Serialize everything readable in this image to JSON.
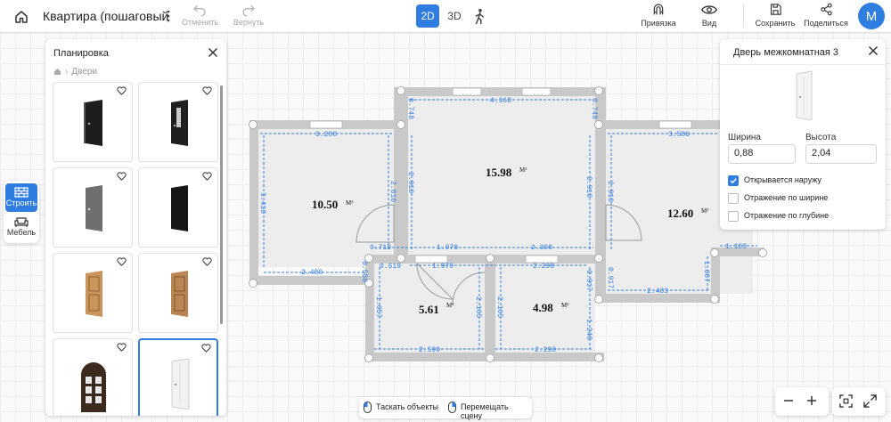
{
  "header": {
    "project_title": "Квартира (пошаговый",
    "undo_label": "Отменить",
    "redo_label": "Вернуть",
    "mode_2d": "2D",
    "mode_3d": "3D",
    "snap_label": "Привязка",
    "view_label": "Вид",
    "save_label": "Сохранить",
    "share_label": "Поделиться",
    "avatar_letter": "M"
  },
  "side_toolbar": {
    "build_label": "Строить",
    "furniture_label": "Мебель"
  },
  "catalog": {
    "title": "Планировка",
    "breadcrumb": "Двери"
  },
  "properties": {
    "title": "Дверь межкомнатная 3",
    "width_label": "Ширина",
    "width_value": "0,88",
    "height_label": "Высота",
    "height_value": "2,04",
    "options": [
      {
        "label": "Открывается наружу",
        "checked": true
      },
      {
        "label": "Отражение по ширине",
        "checked": false
      },
      {
        "label": "Отражение по глубине",
        "checked": false
      }
    ]
  },
  "plan": {
    "rooms": [
      {
        "area": "10.50",
        "unit": "M²"
      },
      {
        "area": "15.98",
        "unit": "M²"
      },
      {
        "area": "12.60",
        "unit": "M²"
      },
      {
        "area": "5.61",
        "unit": "M²"
      },
      {
        "area": "4.98",
        "unit": "M²"
      }
    ],
    "dimensions": [
      "3.200",
      "4.368",
      "3.586",
      "0.748",
      "0.748",
      "3.418",
      "2.810",
      "2.910",
      "2.910",
      "2.910",
      "0.719",
      "1.970",
      "2.398",
      "1.970",
      "2.298",
      "0.619",
      "0.580",
      "2.480",
      "0.917",
      "0.917",
      "2.483",
      "1.103",
      "1.087",
      "1.657",
      "2.165",
      "2.165",
      "1.248",
      "2.590",
      "2.298"
    ]
  },
  "hints": {
    "drag_objects": "Таскать объекты",
    "move_scene": "Перемещать сцену"
  },
  "colors": {
    "accent": "#2f7de1",
    "wall": "#c9c9c9",
    "dimension": "#2f7de1"
  }
}
